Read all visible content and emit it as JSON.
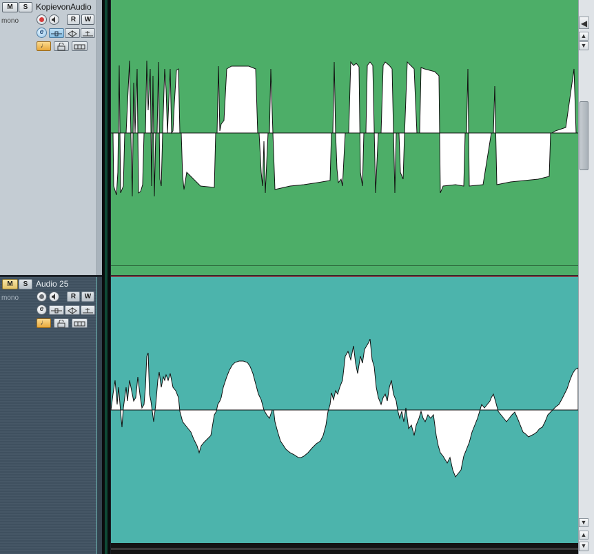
{
  "tracks": [
    {
      "name": "KopievonAudio",
      "channel": "mono",
      "mute_label": "M",
      "solo_label": "S",
      "read_label": "R",
      "write_label": "W",
      "record_armed": true,
      "color": "#4dae68"
    },
    {
      "name": "Audio 25",
      "channel": "mono",
      "mute_label": "M",
      "solo_label": "S",
      "read_label": "R",
      "write_label": "W",
      "record_armed": false,
      "color": "#4cb4ac"
    }
  ],
  "icons": {
    "edit": "e",
    "record": "record-icon",
    "monitor": "monitor-icon",
    "lock": "lock-icon",
    "lanes": "lanes-icon",
    "note": "♩",
    "scroll_up": "▲",
    "scroll_down": "▼",
    "scroll_left": "◀"
  },
  "colors": {
    "header_light": "#c4ccd3",
    "header_dark": "#465766",
    "waveform": "#ffffff",
    "record_red": "#d43b3b"
  }
}
